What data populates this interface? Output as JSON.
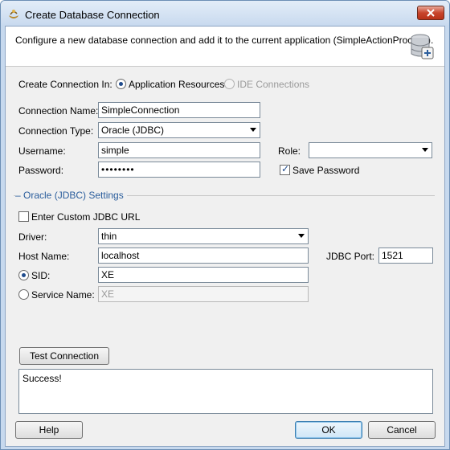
{
  "window": {
    "title": "Create Database Connection",
    "description": "Configure a new database connection and add it to the current application (SimpleActionProcess)."
  },
  "create_in": {
    "label": "Create Connection In:",
    "options": [
      {
        "label": "Application Resources",
        "selected": true,
        "enabled": true
      },
      {
        "label": "IDE Connections",
        "selected": false,
        "enabled": false
      }
    ]
  },
  "connection": {
    "name_label": "Connection Name:",
    "name_value": "SimpleConnection",
    "type_label": "Connection Type:",
    "type_value": "Oracle (JDBC)",
    "username_label": "Username:",
    "username_value": "simple",
    "password_label": "Password:",
    "password_value": "••••••••",
    "role_label": "Role:",
    "role_value": "",
    "save_password_label": "Save Password",
    "save_password_checked": true
  },
  "settings": {
    "section_title": "Oracle (JDBC) Settings",
    "custom_url_label": "Enter Custom JDBC URL",
    "custom_url_checked": false,
    "driver_label": "Driver:",
    "driver_value": "thin",
    "host_label": "Host Name:",
    "host_value": "localhost",
    "port_label": "JDBC Port:",
    "port_value": "1521",
    "sid_label": "SID:",
    "sid_value": "XE",
    "service_label": "Service Name:",
    "service_value": "XE"
  },
  "test": {
    "button_label": "Test Connection",
    "result_text": "Success!"
  },
  "footer": {
    "help_label": "Help",
    "ok_label": "OK",
    "cancel_label": "Cancel"
  },
  "colors": {
    "section_title": "#2a5d9c",
    "close_button": "#c8452c"
  }
}
